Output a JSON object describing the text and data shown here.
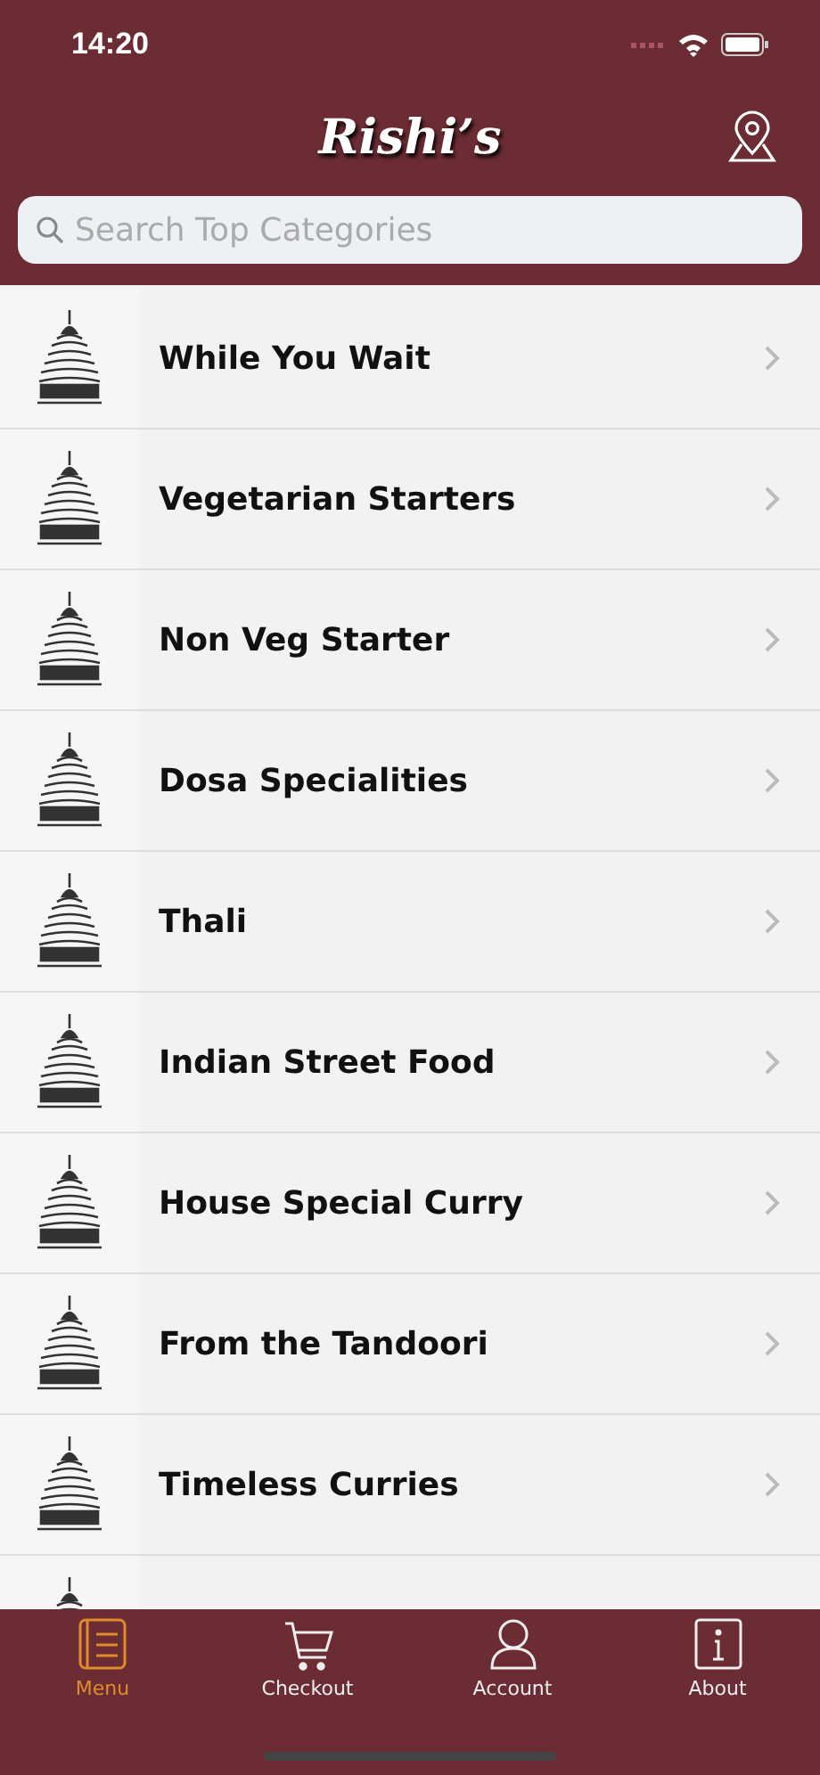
{
  "status_bar": {
    "time": "14:20"
  },
  "header": {
    "title": "Rishi’s"
  },
  "search": {
    "placeholder": "Search Top Categories"
  },
  "categories": [
    {
      "name": "While You Wait"
    },
    {
      "name": "Vegetarian Starters"
    },
    {
      "name": "Non Veg Starter"
    },
    {
      "name": "Dosa Specialities"
    },
    {
      "name": "Thali"
    },
    {
      "name": "Indian Street Food"
    },
    {
      "name": "House Special Curry"
    },
    {
      "name": "From the Tandoori"
    },
    {
      "name": "Timeless Curries"
    }
  ],
  "tab_bar": [
    {
      "label": "Menu",
      "kind": "menu",
      "selected": true
    },
    {
      "label": "Checkout",
      "kind": "cart",
      "selected": false
    },
    {
      "label": "Account",
      "kind": "account",
      "selected": false
    },
    {
      "label": "About",
      "kind": "about",
      "selected": false
    }
  ]
}
